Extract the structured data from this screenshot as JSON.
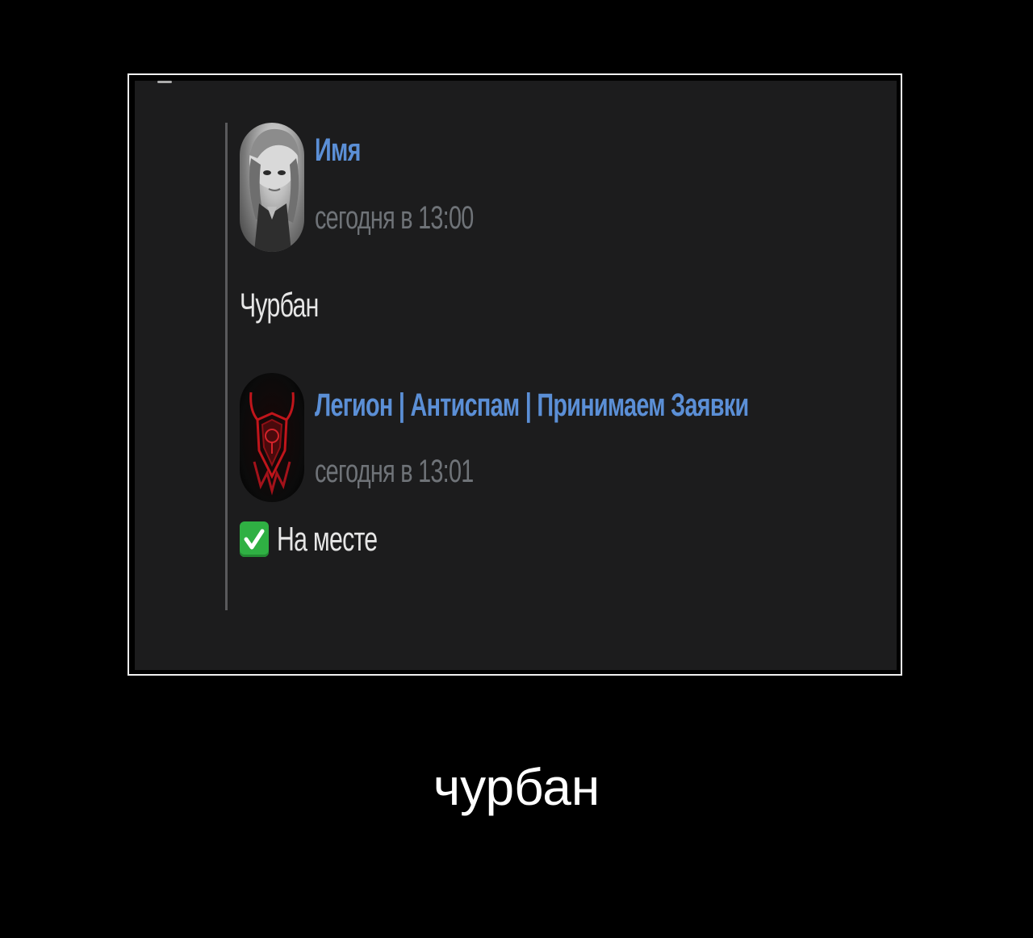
{
  "screenshot": {
    "posts": [
      {
        "author": "Имя",
        "time": "сегодня в 13:00",
        "text": "Чурбан",
        "avatar_icon": "anime-character-avatar-icon"
      },
      {
        "author": "Легион | Антиспам | Принимаем Заявки",
        "time": "сегодня в 13:01",
        "text": "На месте",
        "avatar_icon": "red-demon-emblem-avatar-icon",
        "emoji_icon": "green-check-mark-icon"
      }
    ]
  },
  "caption": "чурбан",
  "colors": {
    "background": "#000000",
    "frame_border": "#f2f2f2",
    "screen_background": "#1c1c1d",
    "author_name": "#5b8fd6",
    "timestamp": "#6f7378",
    "message_text": "#e6e6e6",
    "check_emoji": "#2fb043",
    "emblem_red": "#c0151b"
  }
}
